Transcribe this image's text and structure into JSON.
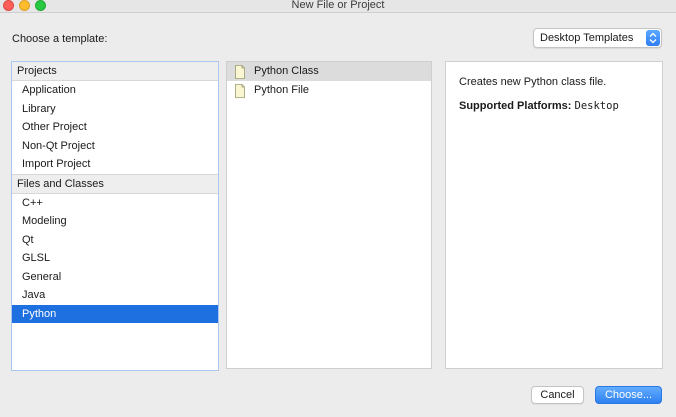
{
  "window": {
    "title": "New File or Project"
  },
  "header": {
    "choose_label": "Choose a template:"
  },
  "template_filter": {
    "selected": "Desktop Templates"
  },
  "categories": {
    "groups": [
      {
        "label": "Projects",
        "items": [
          "Application",
          "Library",
          "Other Project",
          "Non-Qt Project",
          "Import Project"
        ]
      },
      {
        "label": "Files and Classes",
        "items": [
          "C++",
          "Modeling",
          "Qt",
          "GLSL",
          "General",
          "Java",
          "Python"
        ]
      }
    ],
    "selected_item": "Python"
  },
  "templates": {
    "items": [
      {
        "label": "Python Class",
        "icon": "python-file-icon",
        "selected": true
      },
      {
        "label": "Python File",
        "icon": "python-file-icon",
        "selected": false
      }
    ]
  },
  "details": {
    "description": "Creates new Python class file.",
    "platforms_label": "Supported Platforms:",
    "platforms_value": "Desktop"
  },
  "buttons": {
    "cancel": "Cancel",
    "choose": "Choose..."
  },
  "colors": {
    "selection": "#1e6fe0",
    "accent_button": "#2f80f1"
  }
}
